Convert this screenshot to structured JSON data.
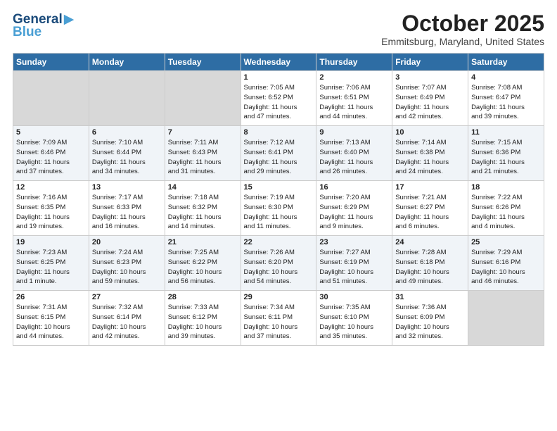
{
  "header": {
    "logo_line1": "General",
    "logo_line2": "Blue",
    "month": "October 2025",
    "location": "Emmitsburg, Maryland, United States"
  },
  "days_of_week": [
    "Sunday",
    "Monday",
    "Tuesday",
    "Wednesday",
    "Thursday",
    "Friday",
    "Saturday"
  ],
  "weeks": [
    [
      {
        "day": "",
        "info": ""
      },
      {
        "day": "",
        "info": ""
      },
      {
        "day": "",
        "info": ""
      },
      {
        "day": "1",
        "info": "Sunrise: 7:05 AM\nSunset: 6:52 PM\nDaylight: 11 hours\nand 47 minutes."
      },
      {
        "day": "2",
        "info": "Sunrise: 7:06 AM\nSunset: 6:51 PM\nDaylight: 11 hours\nand 44 minutes."
      },
      {
        "day": "3",
        "info": "Sunrise: 7:07 AM\nSunset: 6:49 PM\nDaylight: 11 hours\nand 42 minutes."
      },
      {
        "day": "4",
        "info": "Sunrise: 7:08 AM\nSunset: 6:47 PM\nDaylight: 11 hours\nand 39 minutes."
      }
    ],
    [
      {
        "day": "5",
        "info": "Sunrise: 7:09 AM\nSunset: 6:46 PM\nDaylight: 11 hours\nand 37 minutes."
      },
      {
        "day": "6",
        "info": "Sunrise: 7:10 AM\nSunset: 6:44 PM\nDaylight: 11 hours\nand 34 minutes."
      },
      {
        "day": "7",
        "info": "Sunrise: 7:11 AM\nSunset: 6:43 PM\nDaylight: 11 hours\nand 31 minutes."
      },
      {
        "day": "8",
        "info": "Sunrise: 7:12 AM\nSunset: 6:41 PM\nDaylight: 11 hours\nand 29 minutes."
      },
      {
        "day": "9",
        "info": "Sunrise: 7:13 AM\nSunset: 6:40 PM\nDaylight: 11 hours\nand 26 minutes."
      },
      {
        "day": "10",
        "info": "Sunrise: 7:14 AM\nSunset: 6:38 PM\nDaylight: 11 hours\nand 24 minutes."
      },
      {
        "day": "11",
        "info": "Sunrise: 7:15 AM\nSunset: 6:36 PM\nDaylight: 11 hours\nand 21 minutes."
      }
    ],
    [
      {
        "day": "12",
        "info": "Sunrise: 7:16 AM\nSunset: 6:35 PM\nDaylight: 11 hours\nand 19 minutes."
      },
      {
        "day": "13",
        "info": "Sunrise: 7:17 AM\nSunset: 6:33 PM\nDaylight: 11 hours\nand 16 minutes."
      },
      {
        "day": "14",
        "info": "Sunrise: 7:18 AM\nSunset: 6:32 PM\nDaylight: 11 hours\nand 14 minutes."
      },
      {
        "day": "15",
        "info": "Sunrise: 7:19 AM\nSunset: 6:30 PM\nDaylight: 11 hours\nand 11 minutes."
      },
      {
        "day": "16",
        "info": "Sunrise: 7:20 AM\nSunset: 6:29 PM\nDaylight: 11 hours\nand 9 minutes."
      },
      {
        "day": "17",
        "info": "Sunrise: 7:21 AM\nSunset: 6:27 PM\nDaylight: 11 hours\nand 6 minutes."
      },
      {
        "day": "18",
        "info": "Sunrise: 7:22 AM\nSunset: 6:26 PM\nDaylight: 11 hours\nand 4 minutes."
      }
    ],
    [
      {
        "day": "19",
        "info": "Sunrise: 7:23 AM\nSunset: 6:25 PM\nDaylight: 11 hours\nand 1 minute."
      },
      {
        "day": "20",
        "info": "Sunrise: 7:24 AM\nSunset: 6:23 PM\nDaylight: 10 hours\nand 59 minutes."
      },
      {
        "day": "21",
        "info": "Sunrise: 7:25 AM\nSunset: 6:22 PM\nDaylight: 10 hours\nand 56 minutes."
      },
      {
        "day": "22",
        "info": "Sunrise: 7:26 AM\nSunset: 6:20 PM\nDaylight: 10 hours\nand 54 minutes."
      },
      {
        "day": "23",
        "info": "Sunrise: 7:27 AM\nSunset: 6:19 PM\nDaylight: 10 hours\nand 51 minutes."
      },
      {
        "day": "24",
        "info": "Sunrise: 7:28 AM\nSunset: 6:18 PM\nDaylight: 10 hours\nand 49 minutes."
      },
      {
        "day": "25",
        "info": "Sunrise: 7:29 AM\nSunset: 6:16 PM\nDaylight: 10 hours\nand 46 minutes."
      }
    ],
    [
      {
        "day": "26",
        "info": "Sunrise: 7:31 AM\nSunset: 6:15 PM\nDaylight: 10 hours\nand 44 minutes."
      },
      {
        "day": "27",
        "info": "Sunrise: 7:32 AM\nSunset: 6:14 PM\nDaylight: 10 hours\nand 42 minutes."
      },
      {
        "day": "28",
        "info": "Sunrise: 7:33 AM\nSunset: 6:12 PM\nDaylight: 10 hours\nand 39 minutes."
      },
      {
        "day": "29",
        "info": "Sunrise: 7:34 AM\nSunset: 6:11 PM\nDaylight: 10 hours\nand 37 minutes."
      },
      {
        "day": "30",
        "info": "Sunrise: 7:35 AM\nSunset: 6:10 PM\nDaylight: 10 hours\nand 35 minutes."
      },
      {
        "day": "31",
        "info": "Sunrise: 7:36 AM\nSunset: 6:09 PM\nDaylight: 10 hours\nand 32 minutes."
      },
      {
        "day": "",
        "info": ""
      }
    ]
  ]
}
